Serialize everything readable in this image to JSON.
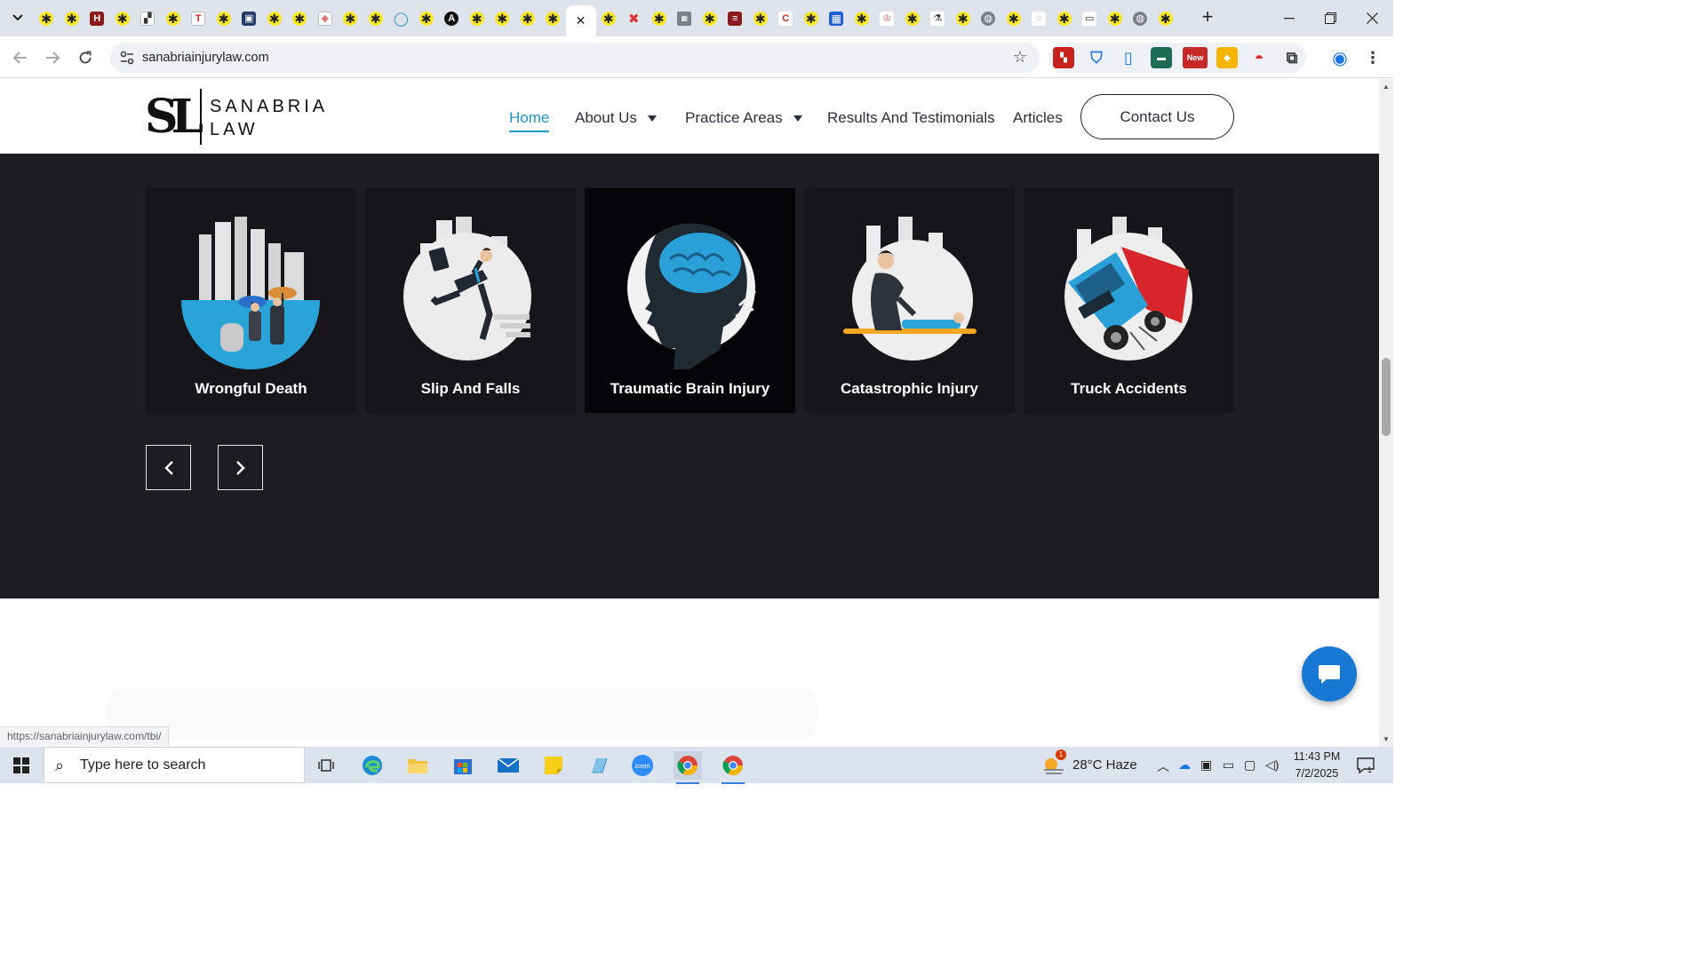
{
  "browser": {
    "url": "sanabriainjurylaw.com",
    "status_url": "https://sanabriainjurylaw.com/tbi/",
    "new_badge": "New"
  },
  "site": {
    "logo_mark": "SL",
    "logo_line1": "SANABRIA",
    "logo_line2": "LAW",
    "nav": {
      "home": "Home",
      "about": "About Us",
      "practice": "Practice Areas",
      "results": "Results And Testimonials",
      "articles": "Articles",
      "contact": "Contact Us"
    },
    "accent_color": "#2196c9",
    "dark_bg_color": "#1c1c22"
  },
  "practice_cards": [
    {
      "title": "Wrongful Death",
      "icon": "wrongful-death-illustration"
    },
    {
      "title": "Slip And Falls",
      "icon": "slip-and-fall-illustration"
    },
    {
      "title": "Traumatic Brain Injury",
      "icon": "brain-injury-illustration"
    },
    {
      "title": "Catastrophic Injury",
      "icon": "catastrophic-injury-illustration"
    },
    {
      "title": "Truck Accidents",
      "icon": "truck-accident-illustration"
    }
  ],
  "carousel": {
    "prev": "‹",
    "next": "›"
  },
  "taskbar": {
    "search_placeholder": "Type here to search",
    "weather": "28°C  Haze",
    "weather_badge": "1",
    "time": "11:43 PM",
    "date": "7/2/2025",
    "notif_count": "1"
  }
}
